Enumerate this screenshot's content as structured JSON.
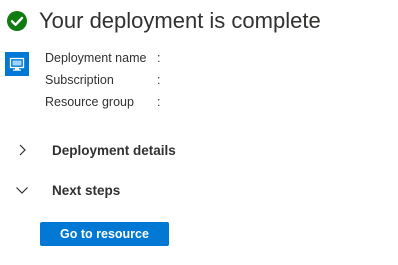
{
  "header": {
    "title": "Your deployment is complete",
    "status_icon": "check-circle-icon",
    "status_color": "#107c10"
  },
  "resource_icon": "virtual-machine-icon",
  "accent_color": "#0078d4",
  "info": {
    "rows": [
      {
        "label": "Deployment name",
        "separator": ":",
        "value": ""
      },
      {
        "label": "Subscription",
        "separator": ":",
        "value": ""
      },
      {
        "label": "Resource group",
        "separator": ":",
        "value": ""
      }
    ]
  },
  "sections": {
    "details": {
      "label": "Deployment details",
      "expanded": false,
      "icon": "chevron-right-icon"
    },
    "next_steps": {
      "label": "Next steps",
      "expanded": true,
      "icon": "chevron-down-icon"
    }
  },
  "actions": {
    "go_to_resource": "Go to resource"
  }
}
